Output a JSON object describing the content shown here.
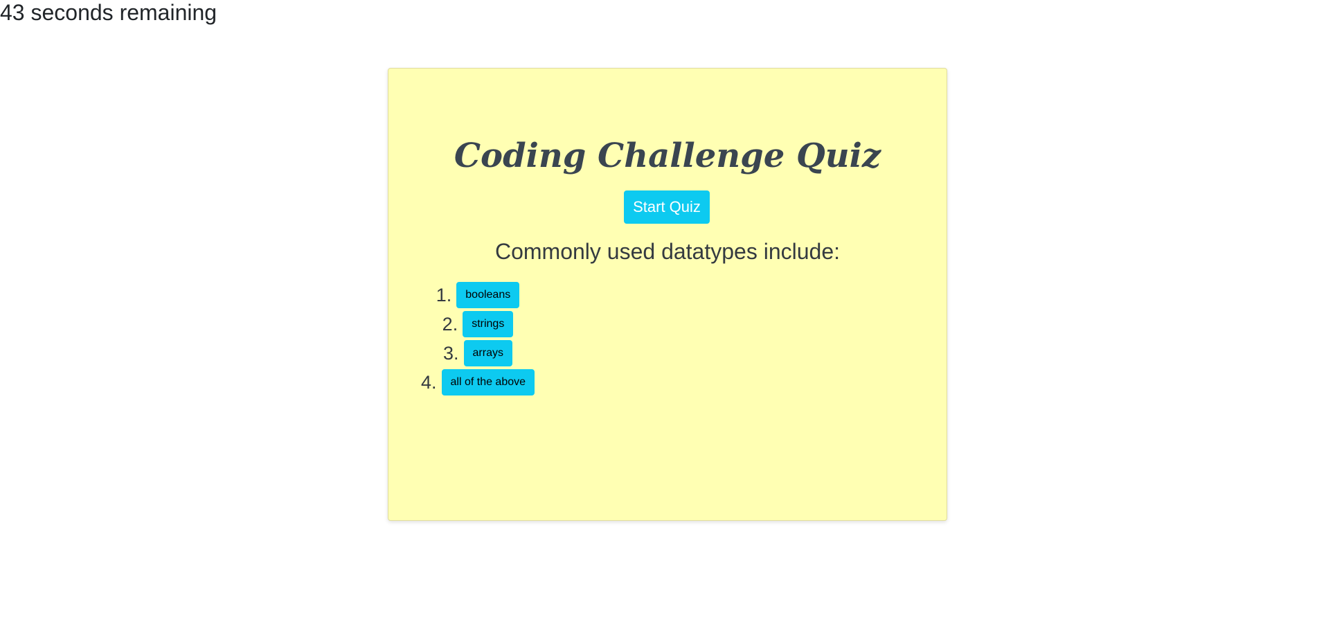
{
  "timer": {
    "text": "43 seconds remaining"
  },
  "card": {
    "title": "Coding Challenge Quiz",
    "start_button_label": "Start Quiz",
    "question": "Commonly used datatypes include:",
    "answers": [
      {
        "number": "1.",
        "label": "booleans"
      },
      {
        "number": "2.",
        "label": "strings"
      },
      {
        "number": "3.",
        "label": "arrays"
      },
      {
        "number": "4.",
        "label": "all of the above"
      }
    ]
  },
  "colors": {
    "card_background": "#ffffb3",
    "button_background": "#0dcaf0",
    "text": "#343a40"
  }
}
